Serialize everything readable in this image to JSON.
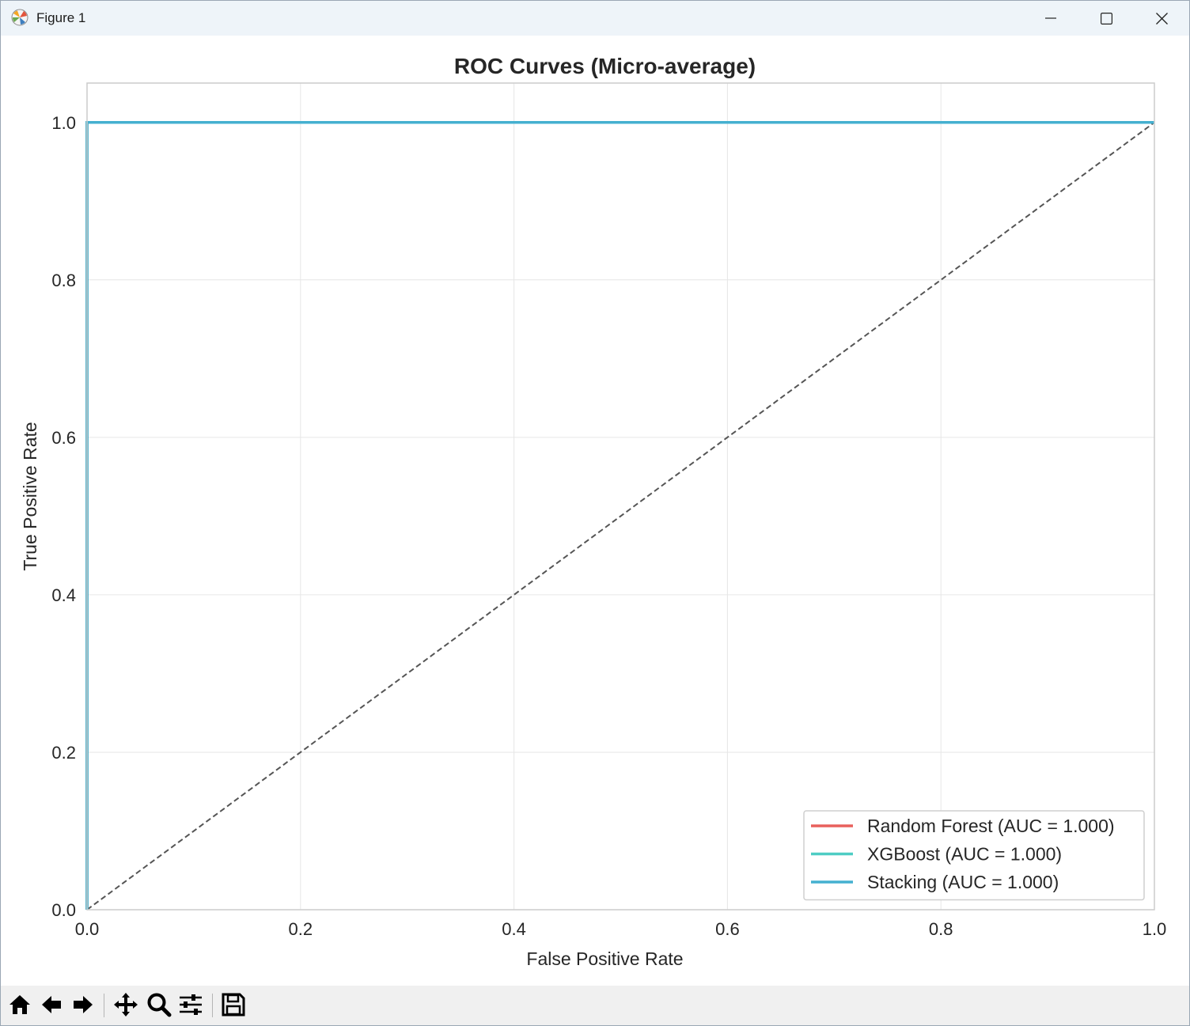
{
  "window": {
    "title": "Figure 1",
    "icons": {
      "app": "matplotlib-icon",
      "minimize": "minimize-icon",
      "maximize": "maximize-icon",
      "close": "close-icon"
    }
  },
  "toolbar": {
    "buttons": [
      "home-icon",
      "back-icon",
      "forward-icon",
      "pan-icon",
      "zoom-icon",
      "configure-subplots-icon",
      "save-icon"
    ]
  },
  "chart_data": {
    "type": "line",
    "title": "ROC Curves (Micro-average)",
    "xlabel": "False Positive Rate",
    "ylabel": "True Positive Rate",
    "xlim": [
      0.0,
      1.0
    ],
    "ylim": [
      0.0,
      1.05
    ],
    "xticks": [
      "0.0",
      "0.2",
      "0.4",
      "0.6",
      "0.8",
      "1.0"
    ],
    "yticks": [
      "0.0",
      "0.2",
      "0.4",
      "0.6",
      "0.8",
      "1.0"
    ],
    "grid": true,
    "legend_position": "lower right",
    "series": [
      {
        "name": "Random Forest (AUC = 1.000)",
        "color": "#e8605c",
        "x": [
          0.0,
          0.0,
          1.0
        ],
        "y": [
          0.0,
          1.0,
          1.0
        ]
      },
      {
        "name": "XGBoost (AUC = 1.000)",
        "color": "#4ecdc4",
        "x": [
          0.0,
          0.0,
          1.0
        ],
        "y": [
          0.0,
          1.0,
          1.0
        ]
      },
      {
        "name": "Stacking (AUC = 1.000)",
        "color": "#45b0d0",
        "x": [
          0.0,
          0.0,
          1.0
        ],
        "y": [
          0.0,
          1.0,
          1.0
        ]
      }
    ],
    "reference_line": {
      "color": "#555555",
      "style": "dashed",
      "x": [
        0.0,
        1.0
      ],
      "y": [
        0.0,
        1.0
      ]
    }
  }
}
